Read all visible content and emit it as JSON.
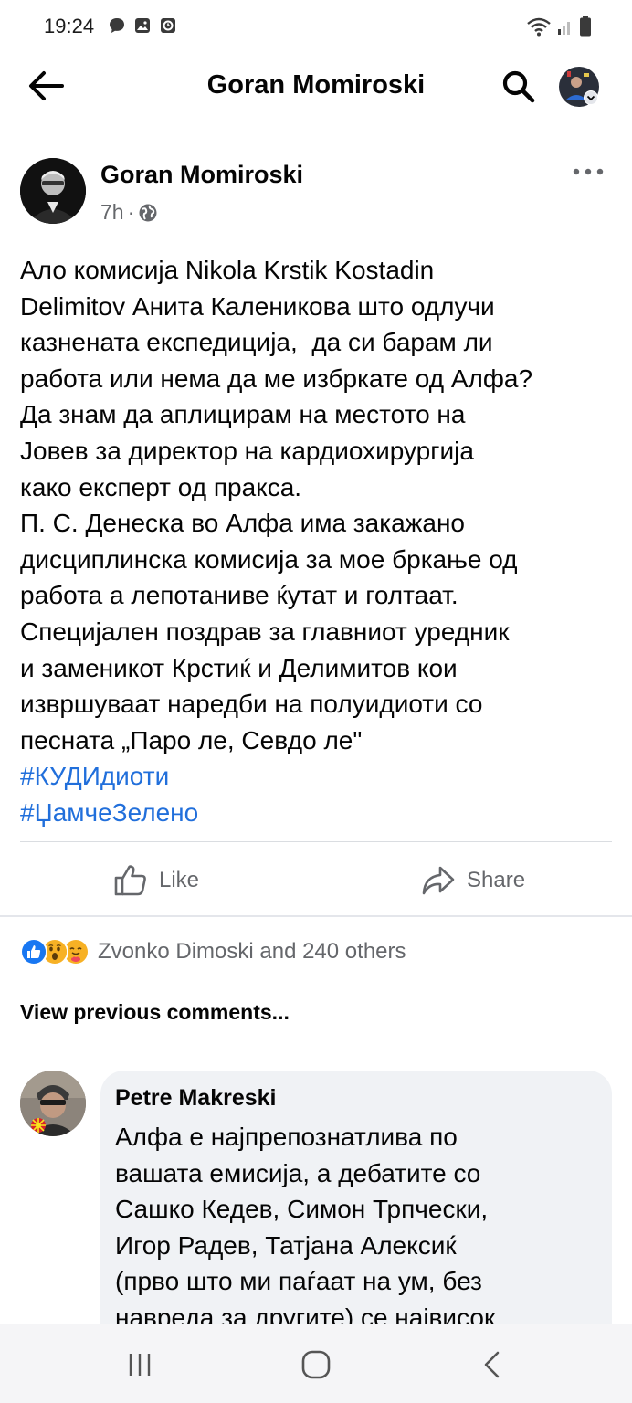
{
  "status_bar": {
    "time": "19:24"
  },
  "header": {
    "title": "Goran Momiroski"
  },
  "post": {
    "author": "Goran Momiroski",
    "time": "7h",
    "separator": "·",
    "privacy_icon": "globe-icon",
    "body_lines": [
      "Ало комисија Nikola Krstik Kostadin",
      "Delimitov Анита Каленикова што одлучи",
      "казнената експедиција,  да си барам ли",
      "работа или нема да ме избркате од Алфа?",
      "Да знам да аплицирам на местото на",
      "Јовев за директор на кардиохирургија",
      "како експерт од пракса.",
      "П. С. Денеска во Алфа има закажано",
      "дисциплинска комисија за мое бркање од",
      "работа а лепотаниве ќутат и голтаат.",
      "Специјален поздрав за главниот уредник",
      "и заменикот Крстиќ и Делимитов кои",
      "извршуваат наредби на полуидиоти со",
      "песната „Паро ле, Севдо ле\""
    ],
    "hashtags": [
      "#КУДИдиоти",
      "#ЏамчеЗелено"
    ],
    "like_label": "Like",
    "share_label": "Share",
    "reactions_text": "Zvonko Dimoski and 240 others",
    "reactions": [
      "like",
      "wow",
      "care"
    ]
  },
  "comments": {
    "view_previous": "View previous comments...",
    "items": [
      {
        "author": "Petre Makreski",
        "lines": [
          "Алфа е најпрепознатлива по",
          "вашата емисија, а дебатите со",
          "Сашко Кедев, Симон Трпчески,",
          "Игор Радев, Татјана Алексиќ",
          "(прво што ми паѓаат на ум, без",
          "навреда за другите) се највисок"
        ]
      }
    ]
  },
  "colors": {
    "text": "#050505",
    "secondary_text": "#65676b",
    "link": "#216fdb",
    "like_blue": "#1877f2",
    "reaction_yellow": "#f7b125",
    "bubble_bg": "#f0f2f5"
  }
}
